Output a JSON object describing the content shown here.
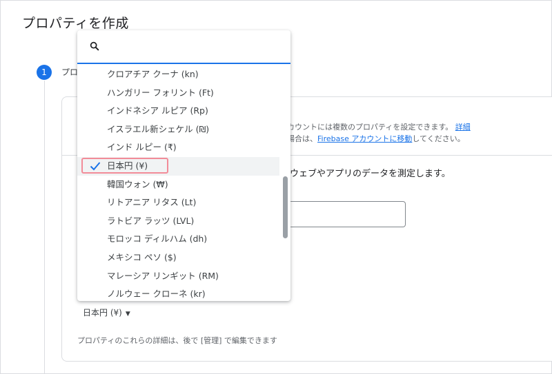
{
  "page": {
    "title": "プロパティを作成",
    "step_number": "1",
    "step_label": "プロ"
  },
  "info": {
    "line1_text": "アカウントには複数のプロパティを設定できます。",
    "line1_link": "詳細",
    "line2_prefix": "る場合は、",
    "line2_link": "Firebase アカウントに移動",
    "line2_suffix": "してください。"
  },
  "measure_text": "ウェブやアプリのデータを測定します。",
  "currency": {
    "selected_label": "日本円 (¥)",
    "footer_note": "プロパティのこれらの詳細は、後で [管理] で編集できます"
  },
  "dropdown": {
    "search_value": "",
    "options": [
      "クロアチア クーナ (kn)",
      "ハンガリー フォリント (Ft)",
      "インドネシア ルピア (Rp)",
      "イスラエル新シェケル (₪)",
      "インド ルピー (₹)",
      "日本円 (¥)",
      "韓国ウォン (₩)",
      "リトアニア リタス (Lt)",
      "ラトビア ラッツ (LVL)",
      "モロッコ ディルハム (dh)",
      "メキシコ ペソ ($)",
      "マレーシア リンギット (RM)",
      "ノルウェー クローネ (kr)"
    ],
    "selected_index": 5
  },
  "colors": {
    "accent": "#1a73e8",
    "highlight_border": "#f28b98",
    "selected_bg": "#f1f3f4"
  },
  "icons": {
    "search": "search-icon",
    "check": "check-icon",
    "caret": "caret-down-icon"
  }
}
